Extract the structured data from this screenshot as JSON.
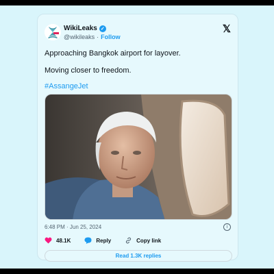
{
  "author": {
    "name": "WikiLeaks",
    "handle": "@wikileaks",
    "separator": "·",
    "follow_label": "Follow",
    "verified_mark": "✓"
  },
  "platform": {
    "logo": "𝕏"
  },
  "tweet": {
    "line1": "Approaching Bangkok airport for layover.",
    "line2": "Moving closer to freedom.",
    "hashtag": "#AssangeJet"
  },
  "meta": {
    "timestamp": "6:48 PM · Jun 25, 2024",
    "info_glyph": "i"
  },
  "actions": {
    "likes_count": "48.1K",
    "reply_label": "Reply",
    "copy_link_label": "Copy link"
  },
  "read_replies_label": "Read 1.3K replies",
  "icons": {
    "avatar": "wikileaks-hourglass-logo",
    "verified": "verified-badge-icon",
    "platform": "x-logo-icon",
    "like": "heart-icon",
    "reply": "speech-bubble-icon",
    "copy_link": "link-icon",
    "info": "info-icon"
  },
  "colors": {
    "accent": "#1d9bf0",
    "like": "#f91880",
    "text": "#0f1419",
    "muted": "#536471",
    "background": "#d9f5fb",
    "card": "#e6f9fd"
  }
}
